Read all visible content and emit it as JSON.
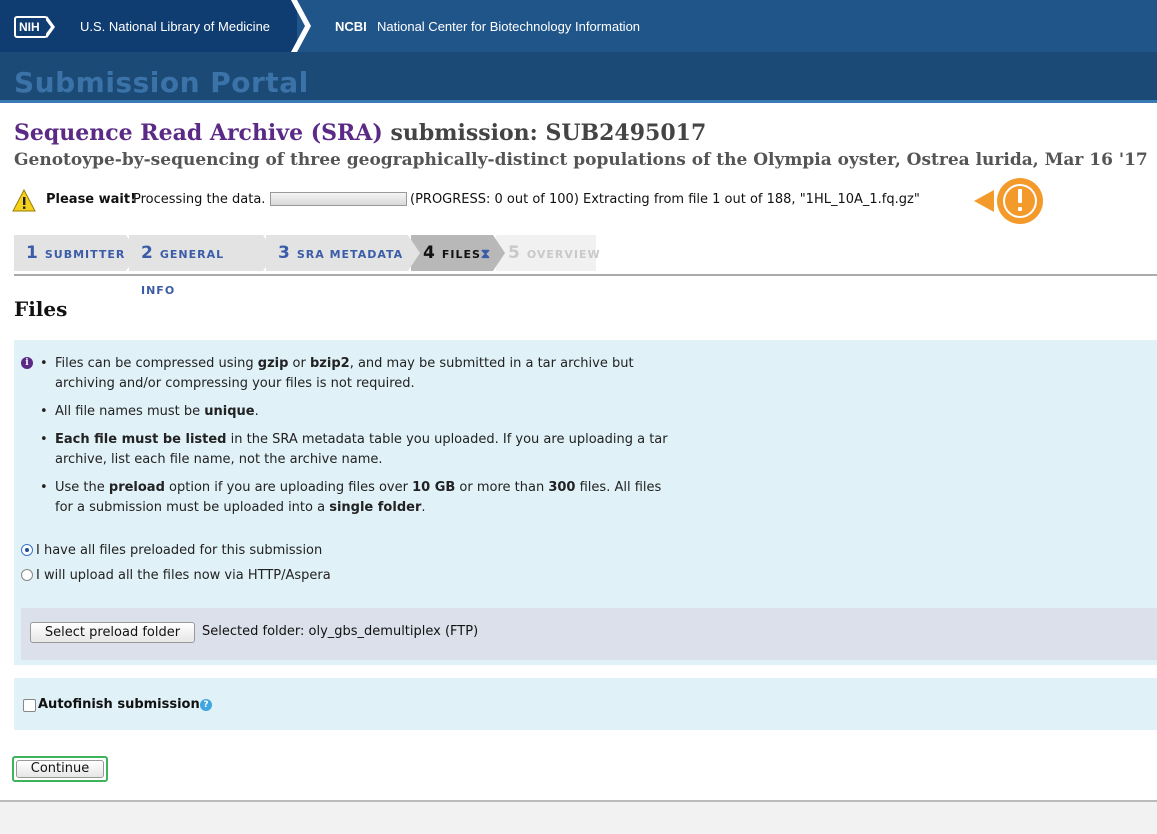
{
  "nih_bar": {
    "logo": "NIH",
    "library": "U.S. National Library of Medicine",
    "ncbi_tag": "NCBI",
    "ncbi_name": "National Center for Biotechnology Information"
  },
  "portal": {
    "title": "Submission Portal"
  },
  "submission": {
    "heading_main": "Sequence Read Archive (SRA)",
    "heading_id": "submission: SUB2495017",
    "description": "Genotoype-by-sequencing of three geographically-distinct populations of the Olympia oyster, Ostrea lurida, Mar 16 '17"
  },
  "status": {
    "wait_strong": "Please wait!",
    "processing": "Processing the data.",
    "progress_fraction": 0,
    "progress_text": "(PROGRESS: 0 out of 100) Extracting from file 1 out of 188, \"1HL_10A_1.fq.gz\""
  },
  "steps": [
    {
      "num": "1",
      "label": "SUBMITTER"
    },
    {
      "num": "2",
      "label": "GENERAL INFO"
    },
    {
      "num": "3",
      "label": "SRA METADATA"
    },
    {
      "num": "4",
      "label": "FILES"
    },
    {
      "num": "5",
      "label": "OVERVIEW"
    }
  ],
  "files": {
    "title": "Files",
    "bullets": {
      "b1_a": "Files can be compressed using ",
      "b1_gzip": "gzip",
      "b1_or": " or ",
      "b1_bzip2": "bzip2",
      "b1_rest": ", and may be submitted in a tar archive but archiving and/or compressing your files is not required.",
      "b2_a": "All file names must be ",
      "b2_unique": "unique",
      "b2_end": ".",
      "b3_strong": "Each file must be listed",
      "b3_rest": " in the SRA metadata table you uploaded. If you are uploading a tar archive, list each file name, not the archive name.",
      "b4_a": "Use the ",
      "b4_preload": "preload",
      "b4_b": " option if you are uploading files over ",
      "b4_10gb": "10 GB",
      "b4_c": " or more than ",
      "b4_300": "300",
      "b4_d": " files. All files for a submission must be uploaded into a ",
      "b4_single": "single folder",
      "b4_end": "."
    },
    "radio_preloaded": "I have all files preloaded for this submission",
    "radio_upload": "I will upload all the files now via HTTP/Aspera",
    "select_folder_button": "Select preload folder",
    "selected_folder": "Selected folder: oly_gbs_demultiplex (FTP)",
    "autofinish_label": "Autofinish submission",
    "help_glyph": "?",
    "continue_button": "Continue"
  },
  "icons": {
    "warning": "warning-triangle-icon",
    "alert_badge": "exclamation-badge-icon",
    "info": "info-icon",
    "help": "question-icon",
    "hourglass": "hourglass-icon"
  },
  "colors": {
    "nih_dark": "#0f3d71",
    "nih_blue": "#20558a",
    "portal_bg": "#1c4a76",
    "heading_purple": "#5a2a86",
    "step_blue": "#3b5ca8",
    "info_bg": "#e0f1f7",
    "alert_orange": "#f39a2b",
    "continue_border": "#3fb25c"
  }
}
